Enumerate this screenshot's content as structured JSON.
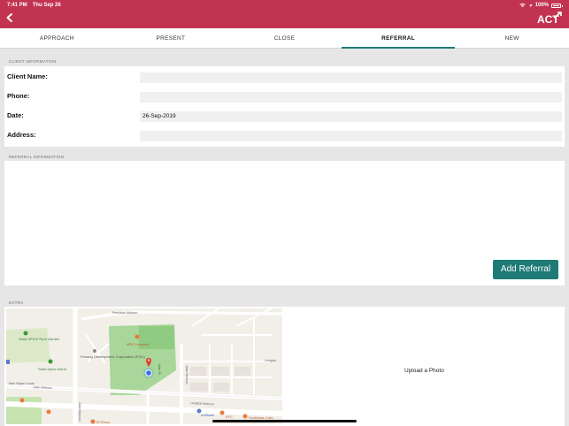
{
  "status_bar": {
    "time": "7:41 PM",
    "date": "Thu Sep 26",
    "battery": "100%"
  },
  "header": {
    "back_icon": "chevron-left-icon",
    "logo_text": "ACT"
  },
  "tabs": [
    {
      "label": "APPROACH",
      "active": false
    },
    {
      "label": "PRESENT",
      "active": false
    },
    {
      "label": "CLOSE",
      "active": false
    },
    {
      "label": "REFERRAL",
      "active": true
    },
    {
      "label": "NEW",
      "active": false
    }
  ],
  "client_information": {
    "section_title": "CLIENT INFORMATION",
    "fields": [
      {
        "label": "Client Name:",
        "value": ""
      },
      {
        "label": "Phone:",
        "value": ""
      },
      {
        "label": "Date:",
        "value": "26-Sep-2019"
      },
      {
        "label": "Address:",
        "value": ""
      }
    ]
  },
  "referral_information": {
    "section_title": "REFERRAL INFORMATION",
    "add_button": "Add Referral"
  },
  "extra": {
    "section_title": "EXTRA",
    "upload_label": "Upload a Photo",
    "map": {
      "labels": {
        "roof_garden": "Setia SPICE Roof Garden",
        "arena": "Setia Spice Arena",
        "pdc": "Penang Development Corporation (PDC)",
        "hospital": "MRC Hospital",
        "road_1": "Jalan Mahsuri",
        "road_2": "Lengkok Mahsuri",
        "road_3": "Jalan Mahsuri",
        "road_4": "Jalan Mahsuri",
        "ambank": "AmBank",
        "kfc": "KFC",
        "southlane": "Southlane Cafe",
        "el_plaza": "El Plaza",
        "persiaran": "Persiaran Mahsuri",
        "lengkok": "Lengkok",
        "jalan_15": "Jalan 15",
        "jalan_bayan": "Jalan Bayan Lepas"
      }
    }
  }
}
